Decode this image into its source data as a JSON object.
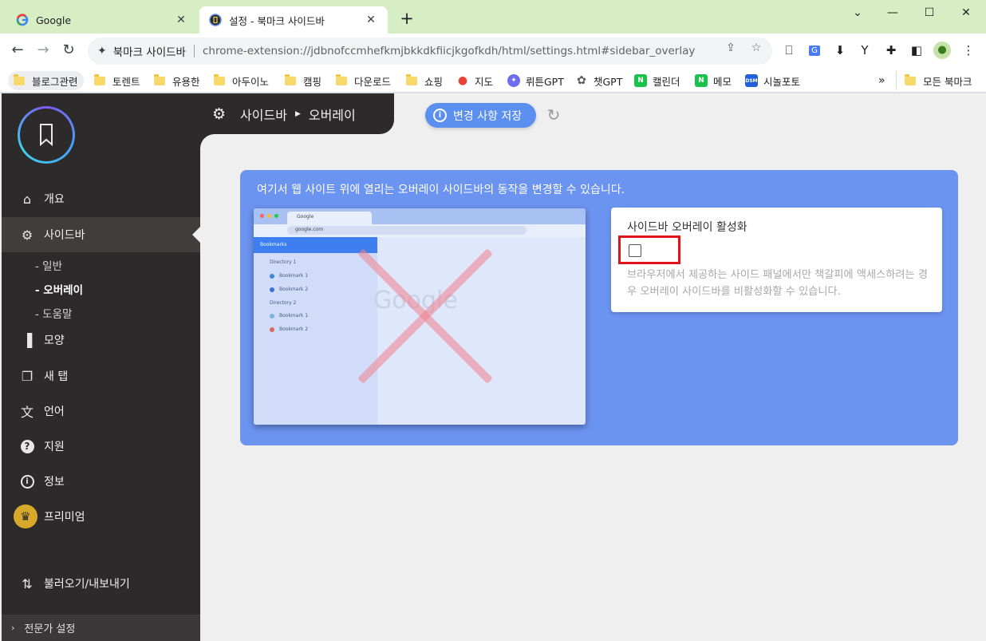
{
  "browser": {
    "tabs": [
      {
        "title": "Google",
        "active": false
      },
      {
        "title": "설정 - 북마크 사이드바",
        "active": true
      }
    ],
    "omnibox": {
      "site_name": "북마크 사이드바",
      "url": "chrome-extension://jdbnofccmhefkmjbkkdkfiicjkgofkdh/html/settings.html#sidebar_overlay"
    },
    "bookmarks": [
      {
        "label": "블로그관련",
        "icon": "folder"
      },
      {
        "label": "토렌트",
        "icon": "folder"
      },
      {
        "label": "유용한",
        "icon": "folder"
      },
      {
        "label": "아두이노",
        "icon": "folder"
      },
      {
        "label": "캠핑",
        "icon": "folder"
      },
      {
        "label": "다운로드",
        "icon": "folder"
      },
      {
        "label": "쇼핑",
        "icon": "folder"
      },
      {
        "label": "지도",
        "icon": "maps"
      },
      {
        "label": "뤼튼GPT",
        "icon": "wrtn"
      },
      {
        "label": "챗GPT",
        "icon": "openai"
      },
      {
        "label": "캘린더",
        "icon": "naver"
      },
      {
        "label": "메모",
        "icon": "naver"
      },
      {
        "label": "시놀포토",
        "icon": "dsm"
      }
    ],
    "bookmarks_overflow": "»",
    "all_bookmarks": "모든 북마크"
  },
  "sidebar": {
    "items": [
      {
        "label": "개요",
        "icon": "home-icon"
      },
      {
        "label": "사이드바",
        "icon": "gear-icon",
        "active": true
      },
      {
        "label": "모양",
        "icon": "paint-roller-icon"
      },
      {
        "label": "새 탭",
        "icon": "new-tab-icon"
      },
      {
        "label": "언어",
        "icon": "translate-icon"
      },
      {
        "label": "지원",
        "icon": "help-icon"
      },
      {
        "label": "정보",
        "icon": "info-icon"
      },
      {
        "label": "프리미엄",
        "icon": "crown-icon"
      }
    ],
    "sub_items": [
      {
        "label": "- 일반"
      },
      {
        "label": "- 오버레이",
        "current": true
      },
      {
        "label": "- 도움말"
      }
    ],
    "import_export": "불러오기/내보내기",
    "expert_settings": "전문가 설정"
  },
  "header": {
    "section": "사이드바",
    "page": "오버레이",
    "save_button": "변경 사항 저장"
  },
  "panel": {
    "description": "여기서 웹 사이트 위에 열리는 오버레이 사이드바의 동작을 변경할 수 있습니다.",
    "preview": {
      "tab_title": "Google",
      "url": "google.com",
      "sidebar_title": "Bookmarks",
      "tree": [
        "Directory 1",
        "Bookmark 1",
        "Bookmark 2",
        "Directory 2",
        "Bookmark 1",
        "Bookmark 2"
      ],
      "logo_text": "Google"
    },
    "setting": {
      "title": "사이드바 오버레이 활성화",
      "checked": false,
      "help": "브라우저에서 제공하는 사이드 패널에서만 책갈피에 액세스하려는 경우 오버레이 사이드바를 비활성화할 수 있습니다."
    }
  },
  "colors": {
    "accent": "#6b93f0",
    "sidebar_bg": "#2c2a2a",
    "highlight": "#e1141c"
  }
}
